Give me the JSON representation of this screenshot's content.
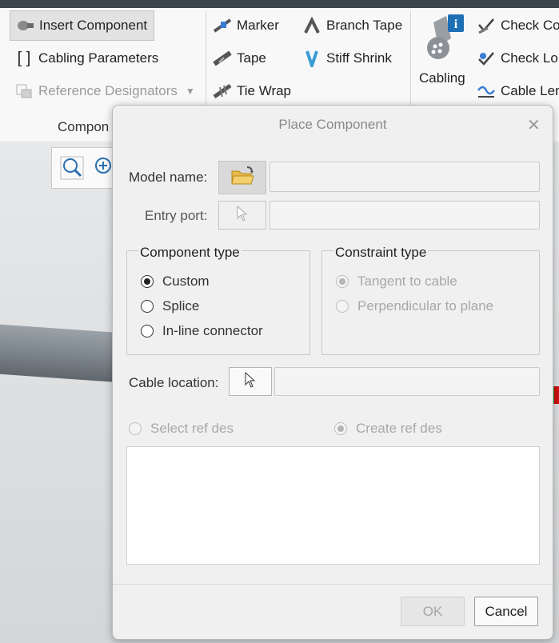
{
  "ribbon": {
    "group1": {
      "insert_component": "Insert Component",
      "cabling_parameters": "Cabling Parameters",
      "reference_designators": "Reference Designators",
      "group_label": "Compon"
    },
    "group2": {
      "marker": "Marker",
      "branch_tape": "Branch Tape",
      "tape": "Tape",
      "stiff_shrink": "Stiff Shrink",
      "tie_wrap": "Tie Wrap"
    },
    "group3": {
      "cabling": "Cabling",
      "check_co": "Check Co",
      "check_lo": "Check Lo",
      "cable_len": "Cable Len"
    }
  },
  "dialog": {
    "title": "Place Component",
    "model_name_label": "Model name:",
    "model_name_value": "",
    "entry_port_label": "Entry port:",
    "entry_port_value": "",
    "component_type": {
      "title": "Component type",
      "options": [
        "Custom",
        "Splice",
        "In-line connector"
      ],
      "selected": "Custom"
    },
    "constraint_type": {
      "title": "Constraint type",
      "options": [
        "Tangent to cable",
        "Perpendicular to plane"
      ],
      "selected": "Tangent to cable"
    },
    "cable_location_label": "Cable location:",
    "cable_location_value": "",
    "select_ref_des": "Select ref des",
    "create_ref_des": "Create ref des",
    "ok": "OK",
    "cancel": "Cancel"
  },
  "colors": {
    "title_bar": "#3c464f",
    "ribbon_bg": "#f8f8f8",
    "dialog_bg": "#f0f0f0"
  }
}
